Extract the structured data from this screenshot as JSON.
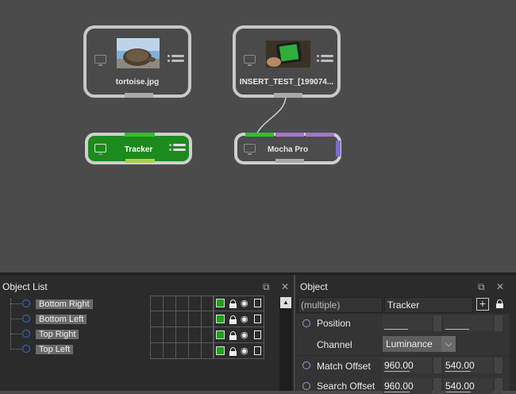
{
  "node_graph": {
    "nodes": {
      "tortoise": {
        "label": "tortoise.jpg"
      },
      "insert_test": {
        "label": "INSERT_TEST_[199074..."
      },
      "tracker": {
        "label": "Tracker"
      },
      "mocha_pro": {
        "label": "Mocha Pro"
      }
    }
  },
  "object_list": {
    "title": "Object List",
    "restore_icon": "⧉",
    "close_icon": "✕",
    "scroll_up": "▲",
    "items": [
      {
        "label": "Bottom Right"
      },
      {
        "label": "Bottom Left"
      },
      {
        "label": "Top Right"
      },
      {
        "label": "Top Left"
      }
    ]
  },
  "object_panel": {
    "title": "Object",
    "restore_icon": "⧉",
    "close_icon": "✕",
    "selection": "(multiple)",
    "tracker_name": "Tracker",
    "add_icon": "+",
    "position_label": "Position",
    "channel_label": "Channel",
    "channel_value": "Luminance",
    "dropdown_icon": "⌵",
    "match_offset_label": "Match Offset",
    "match_offset_x": "960.00",
    "match_offset_y": "540.00",
    "search_offset_label": "Search Offset",
    "search_offset_x": "960.00",
    "search_offset_y": "540.00"
  },
  "colors": {
    "enabled_green": "#1aa31a",
    "tracker_node": "#1c8a1c",
    "mocha_purple": "#a873c8"
  }
}
